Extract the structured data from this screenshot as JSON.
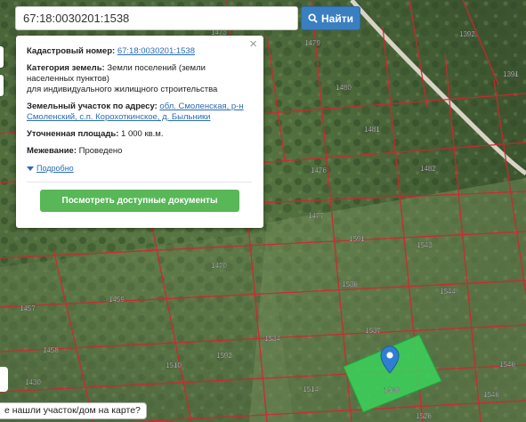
{
  "search": {
    "value": "67:18:0030201:1538",
    "button_label": "Найти"
  },
  "popup": {
    "cadastral_label": "Кадастровый номер:",
    "cadastral_value": "67:18:0030201:1538",
    "category_label": "Категория земель:",
    "category_value": "Земли поселений (земли населенных пунктов)",
    "category_value_2": "для индивидуального жилищного строительства",
    "address_label": "Земельный участок по адресу:",
    "address_value": "обл. Смоленская, р-н Смоленский, с.п. Корохоткинское, д. Быльники",
    "area_label": "Уточненная площадь:",
    "area_value": "1 000 кв.м.",
    "survey_label": "Межевание:",
    "survey_value": "Проведено",
    "more_label": "Подробно",
    "docs_button_label": "Посмотреть доступные документы",
    "close_glyph": "×"
  },
  "bottom_hint": "е нашли участок/дом на карте?",
  "map": {
    "parcel_labels": [
      "1473",
      "1479",
      "1392",
      "1391",
      "1480",
      "1481",
      "1482",
      "1476",
      "1477",
      "1591",
      "1543",
      "1470",
      "1536",
      "1544",
      "1457",
      "1459",
      "1537",
      "1534",
      "1458",
      "1510",
      "1592",
      "1546",
      "1430",
      "1514",
      "1538",
      "1546",
      "1526"
    ],
    "selected_parcel": "1538",
    "colors": {
      "selected_fill": "#3bd35a",
      "marker": "#2f7fd1",
      "boundary": "#d8222f",
      "button": "#3a7fc2",
      "docs_button": "#58b757"
    }
  }
}
